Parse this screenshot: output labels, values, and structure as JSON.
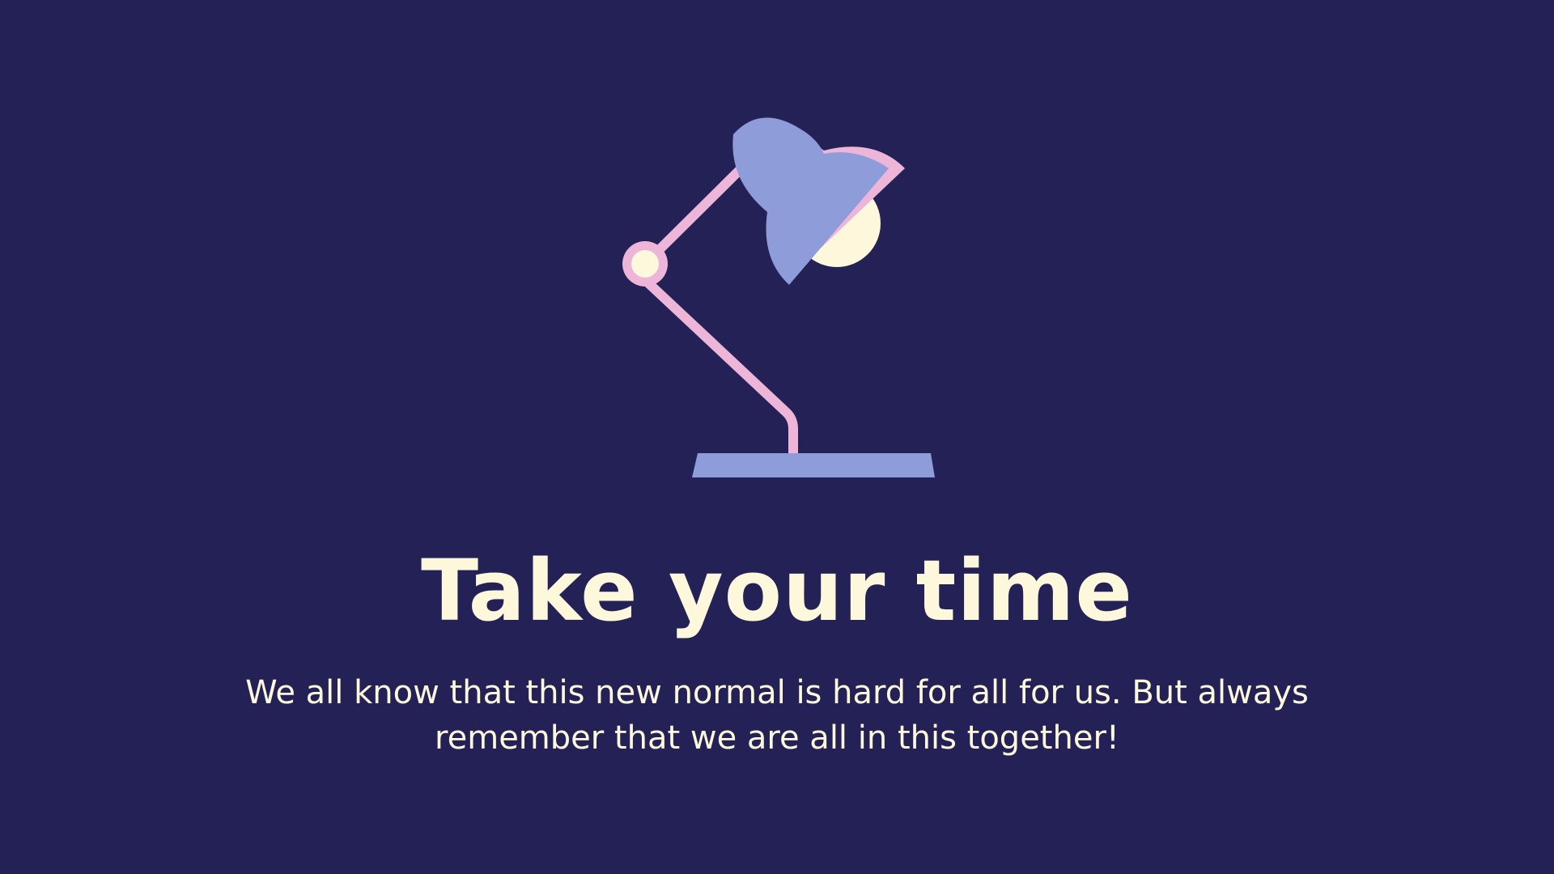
{
  "slide": {
    "title": "Take your time",
    "body": "We all know that this new normal is hard for all for us. But always remember that we are all in this together!"
  },
  "illustration": {
    "name": "desk-lamp-icon"
  },
  "colors": {
    "background": "#242156",
    "text": "#FDF8DC",
    "lamp_shade": "#8E9CDA",
    "lamp_arm": "#EDB5D8",
    "bulb": "#FDF8DC"
  }
}
